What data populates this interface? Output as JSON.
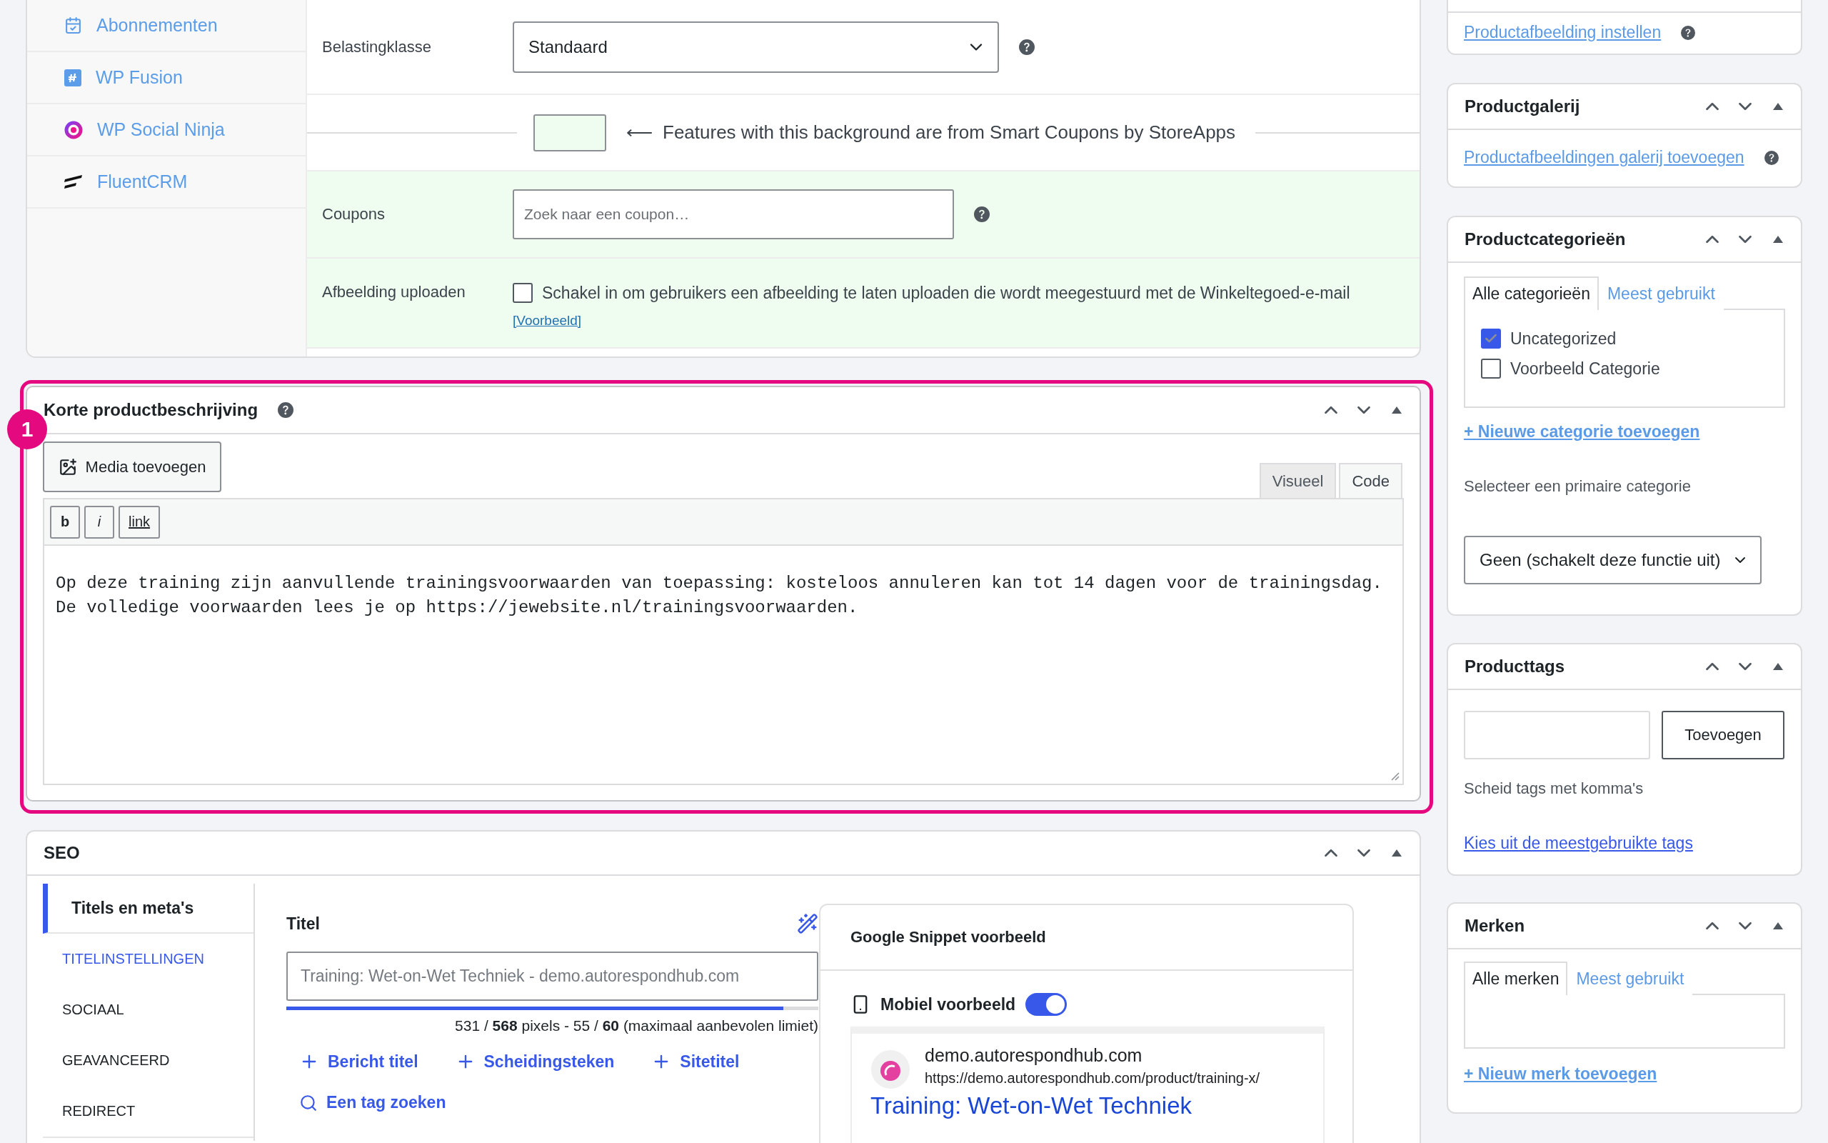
{
  "product_data": {
    "tabs": [
      {
        "label": "Abonnementen"
      },
      {
        "label": "WP Fusion"
      },
      {
        "label": "WP Social Ninja"
      },
      {
        "label": "FluentCRM"
      }
    ],
    "fields": [
      {
        "kind": "select",
        "label": "Belastingklasse",
        "value": "Standaard",
        "smart_coupons": false
      },
      {
        "kind": "notice",
        "arrow": "⟵",
        "text": "Features with this background are from Smart Coupons by StoreApps",
        "smart_coupons": false
      },
      {
        "kind": "search",
        "label": "Coupons",
        "placeholder": "Zoek naar een coupon…",
        "smart_coupons": true
      },
      {
        "kind": "checkbox",
        "label": "Afbeelding uploaden",
        "text": "Schakel in om gebruikers een afbeelding te laten uploaden die wordt meegestuurd met de Winkeltegoed-e-mail",
        "checked": false,
        "link": "[Voorbeeld]",
        "smart_coupons": true
      }
    ]
  },
  "short_description": {
    "badge": "1",
    "title": "Korte productbeschrijving",
    "media_button": "Media toevoegen",
    "editor_tabs": [
      {
        "label": "Visueel",
        "selected": false
      },
      {
        "label": "Code",
        "selected": true
      }
    ],
    "toolbar": [
      {
        "label": "b",
        "kind": "bold"
      },
      {
        "label": "i",
        "kind": "italic"
      },
      {
        "label": "link",
        "kind": "link"
      }
    ],
    "content": "Op deze training zijn aanvullende trainingsvoorwaarden van toepassing: kosteloos annuleren kan tot 14 dagen voor de trainingsdag. De volledige voorwaarden lees je op https://jewebsite.nl/trainingsvoorwaarden."
  },
  "seo": {
    "title": "SEO",
    "nav": [
      {
        "label": "Titels en meta's",
        "selected": true,
        "children": [
          {
            "label": "TITELINSTELLINGEN",
            "selected": true
          },
          {
            "label": "SOCIAAL",
            "selected": false
          },
          {
            "label": "GEAVANCEERD",
            "selected": false
          },
          {
            "label": "REDIRECT",
            "selected": false
          }
        ]
      }
    ],
    "title_field": {
      "label": "Titel",
      "placeholder": "Training: Wet-on-Wet Techniek - demo.autorespondhub.com",
      "level": 0.934,
      "counter": "531 / **568** pixels - 55 / **60** (maximaal aanbevolen limiet)",
      "tags": [
        "Bericht titel",
        "Scheidingsteken",
        "Sitetitel"
      ],
      "search": "Een tag zoeken"
    },
    "snippet": {
      "title": "Google Snippet voorbeeld",
      "mobile_label": "Mobiel voorbeeld",
      "mobile_on": true,
      "domain": "demo.autorespondhub.com",
      "url": "https://demo.autorespondhub.com/product/training-x/",
      "page_title": "Training: Wet-on-Wet Techniek"
    }
  },
  "sidebar": {
    "featured_image": {
      "link": "Productafbeelding instellen"
    },
    "gallery": {
      "title": "Productgalerij",
      "link": "Productafbeeldingen galerij toevoegen"
    },
    "categories": {
      "title": "Productcategorieën",
      "tabs": [
        {
          "label": "Alle categorieën",
          "selected": true
        },
        {
          "label": "Meest gebruikt",
          "selected": false
        }
      ],
      "items": [
        {
          "label": "Uncategorized",
          "checked": true
        },
        {
          "label": "Voorbeeld Categorie",
          "checked": false
        }
      ],
      "add_link": "+ Nieuwe categorie toevoegen",
      "primary_label": "Selecteer een primaire categorie",
      "primary_value": "Geen (schakelt deze functie uit)"
    },
    "tags": {
      "title": "Producttags",
      "button": "Toevoegen",
      "hint": "Scheid tags met komma's",
      "link": "Kies uit de meestgebruikte tags"
    },
    "brands": {
      "title": "Merken",
      "tabs": [
        {
          "label": "Alle merken",
          "selected": true
        },
        {
          "label": "Meest gebruikt",
          "selected": false
        }
      ],
      "add_link": "+ Nieuw merk toevoegen"
    }
  }
}
